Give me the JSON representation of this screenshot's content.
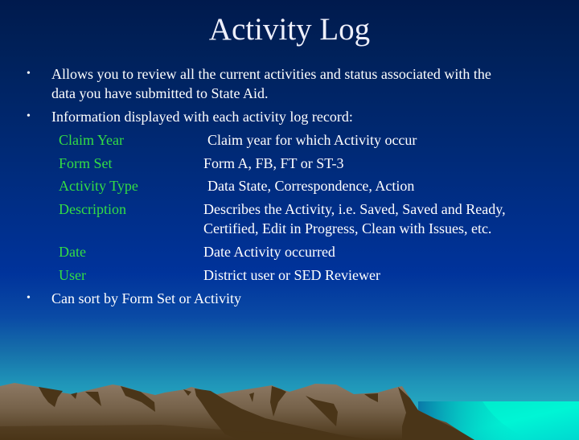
{
  "slide": {
    "title": "Activity Log",
    "bullets": [
      {
        "icon": "bullet-icon",
        "lines": [
          "Allows you to review all the current activities and status associated with the",
          "data you have submitted to State Aid."
        ]
      },
      {
        "icon": "bullet-icon",
        "lines": [
          "Information displayed with each activity log record:"
        ]
      },
      {
        "icon": "bullet-icon",
        "lines": [
          "Can sort by Form Set or Activity"
        ]
      }
    ],
    "fields": [
      {
        "label": "Claim Year",
        "description": [
          "Claim year for which Activity occur"
        ]
      },
      {
        "label": "Form Set",
        "description": [
          "Form A, FB, FT or ST-3"
        ]
      },
      {
        "label": "Activity Type",
        "description": [
          "Data State, Correspondence, Action"
        ]
      },
      {
        "label": "Description",
        "description": [
          "Describes the Activity, i.e. Saved,  Saved and Ready,",
          "Certified, Edit in Progress, Clean with Issues,  etc."
        ]
      },
      {
        "label": "Date",
        "description": [
          "Date Activity occurred"
        ]
      },
      {
        "label": "User",
        "description": [
          "District user or SED Reviewer"
        ]
      }
    ],
    "bullet_glyph": "•",
    "colors": {
      "background_top": "#001a4d",
      "background_mid": "#00339b",
      "horizon": "#25a8c0",
      "sea": "#00f0d0",
      "mountain_light": "#8a7560",
      "mountain_dark": "#4a3518",
      "label_green": "#33dd44",
      "text": "#ffffff"
    },
    "background_image": "mountain-landscape-illustration"
  }
}
